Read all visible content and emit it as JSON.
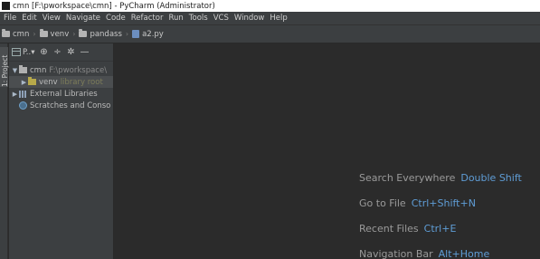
{
  "window": {
    "title": "cmn [F:\\pworkspace\\cmn] - PyCharm (Administrator)"
  },
  "menu": [
    "File",
    "Edit",
    "View",
    "Navigate",
    "Code",
    "Refactor",
    "Run",
    "Tools",
    "VCS",
    "Window",
    "Help"
  ],
  "breadcrumbs": [
    {
      "label": "cmn",
      "icon": "folder-icon"
    },
    {
      "label": "venv",
      "icon": "folder-icon"
    },
    {
      "label": "pandass",
      "icon": "folder-icon"
    },
    {
      "label": "a2.py",
      "icon": "python-file-icon"
    }
  ],
  "side_tab": {
    "label": "1: Project"
  },
  "project_panel": {
    "view_selector": "P..▾",
    "tree": [
      {
        "arrow": "▼",
        "label": "cmn",
        "extra": "F:\\pworkspace\\",
        "icon": "folder-icon",
        "indent": 0,
        "selected": false
      },
      {
        "arrow": "▶",
        "label": "venv",
        "extra": "library root",
        "icon": "venv-folder-icon",
        "indent": 1,
        "selected": true
      },
      {
        "arrow": "▶",
        "label": "External Libraries",
        "extra": "",
        "icon": "library-icon",
        "indent": 0,
        "selected": false
      },
      {
        "arrow": "",
        "label": "Scratches and Conso",
        "extra": "",
        "icon": "scratch-icon",
        "indent": 0,
        "selected": false
      }
    ]
  },
  "editor_hints": [
    {
      "label": "Search Everywhere",
      "shortcut": "Double Shift"
    },
    {
      "label": "Go to File",
      "shortcut": "Ctrl+Shift+N"
    },
    {
      "label": "Recent Files",
      "shortcut": "Ctrl+E"
    },
    {
      "label": "Navigation Bar",
      "shortcut": "Alt+Home"
    }
  ],
  "colors": {
    "background": "#2b2b2b",
    "panel": "#3c3f41",
    "shortcut_accent": "#5f9dd6"
  }
}
